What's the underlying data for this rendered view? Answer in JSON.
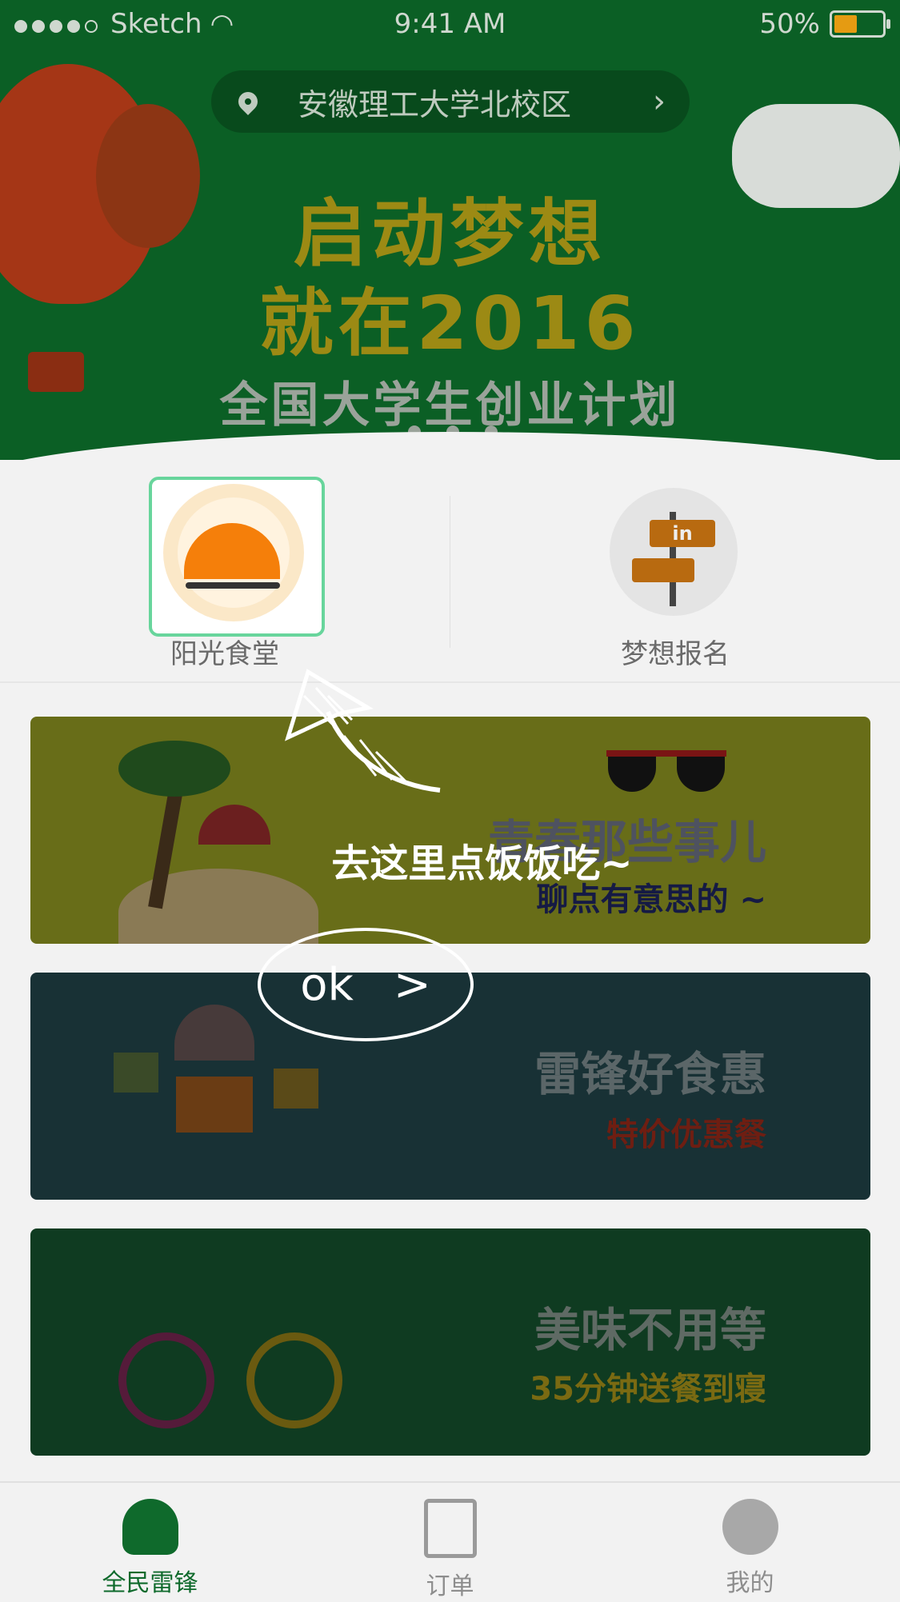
{
  "status_bar": {
    "carrier": "Sketch",
    "time": "9:41 AM",
    "battery": "50%"
  },
  "banner": {
    "location": "安徽理工大学北校区",
    "headline_1": "启动梦想",
    "headline_2": "就在2016",
    "subtitle": "全国大学生创业计划",
    "page_count": 3
  },
  "entries": [
    {
      "label": "阳光食堂"
    },
    {
      "label": "梦想报名"
    }
  ],
  "entry_sign_text": "in",
  "cards": [
    {
      "title": "青春那些事儿",
      "subtitle": "聊点有意思的 ~"
    },
    {
      "title": "雷锋好食惠",
      "subtitle": "特价优惠餐"
    },
    {
      "title": "美味不用等",
      "subtitle": "35分钟送餐到寝"
    }
  ],
  "coach_mark": {
    "hint": "去这里点饭饭吃~",
    "ok_label": "ok",
    "ok_arrow": ">"
  },
  "tabs": [
    {
      "label": "全民雷锋",
      "active": true,
      "icon": "mushroom-icon"
    },
    {
      "label": "订单",
      "active": false,
      "icon": "order-list-icon"
    },
    {
      "label": "我的",
      "active": false,
      "icon": "avatar-icon"
    }
  ],
  "colors": {
    "brand_green": "#0f6a2c",
    "highlight_border": "#68d59c",
    "banner_gold": "#9c8a14"
  }
}
